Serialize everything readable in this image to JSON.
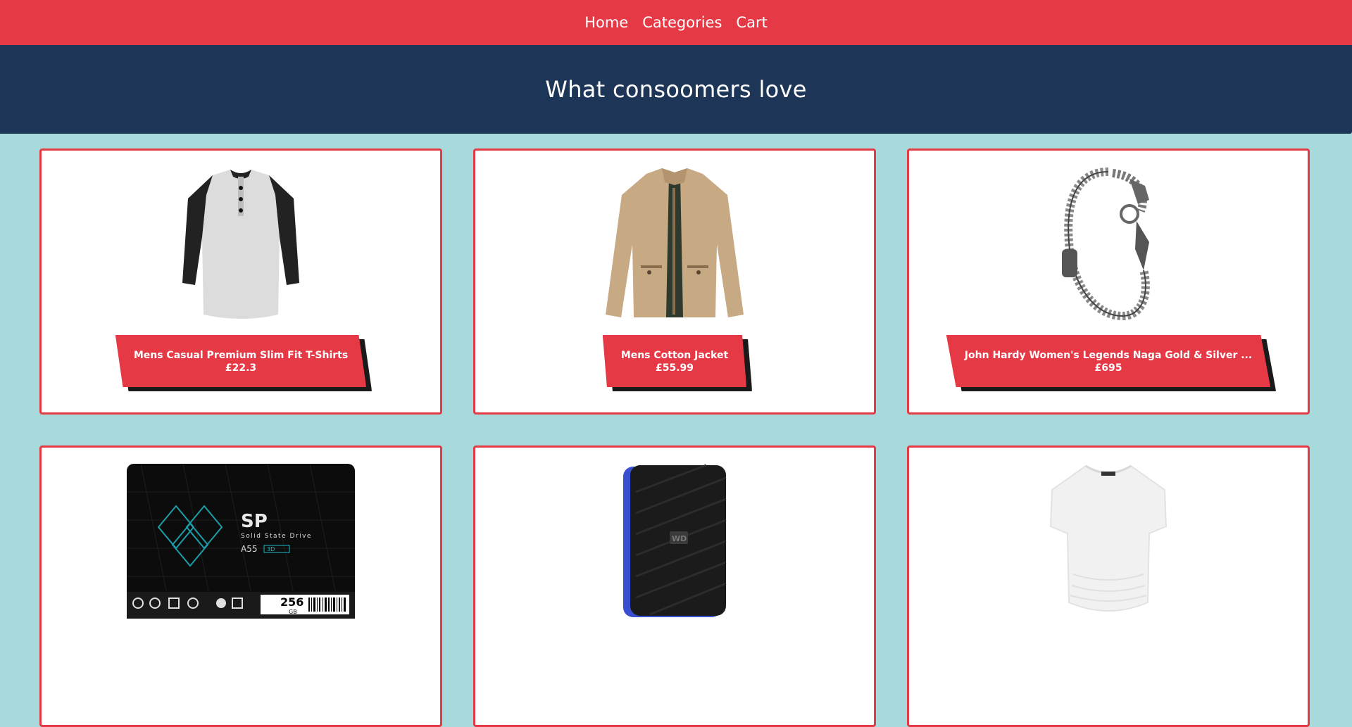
{
  "nav": {
    "items": [
      {
        "label": "Home"
      },
      {
        "label": "Categories"
      },
      {
        "label": "Cart"
      }
    ]
  },
  "hero": {
    "title": "What consoomers love"
  },
  "colors": {
    "nav_bg": "#e63946",
    "hero_bg": "#1d3557",
    "page_bg": "#a8dadc",
    "card_border": "#e63946",
    "label_bg": "#e63946"
  },
  "products": [
    {
      "title": "Mens Casual Premium Slim Fit T-Shirts",
      "price": "£22.3",
      "icon": "tshirt-image"
    },
    {
      "title": "Mens Cotton Jacket",
      "price": "£55.99",
      "icon": "jacket-image"
    },
    {
      "title": "John Hardy Women's Legends Naga Gold & Silver ...",
      "price": "£695",
      "icon": "bracelet-image"
    },
    {
      "title": "",
      "price": "",
      "icon": "ssd-image",
      "image_text": {
        "brand": "SP",
        "line": "Solid State Drive",
        "model": "A55",
        "badge": "3D",
        "capacity": "256",
        "unit": "GB"
      }
    },
    {
      "title": "",
      "price": "",
      "icon": "hard-drive-image",
      "image_text": {
        "logo": "WD"
      }
    },
    {
      "title": "",
      "price": "",
      "icon": "womens-top-image"
    }
  ]
}
